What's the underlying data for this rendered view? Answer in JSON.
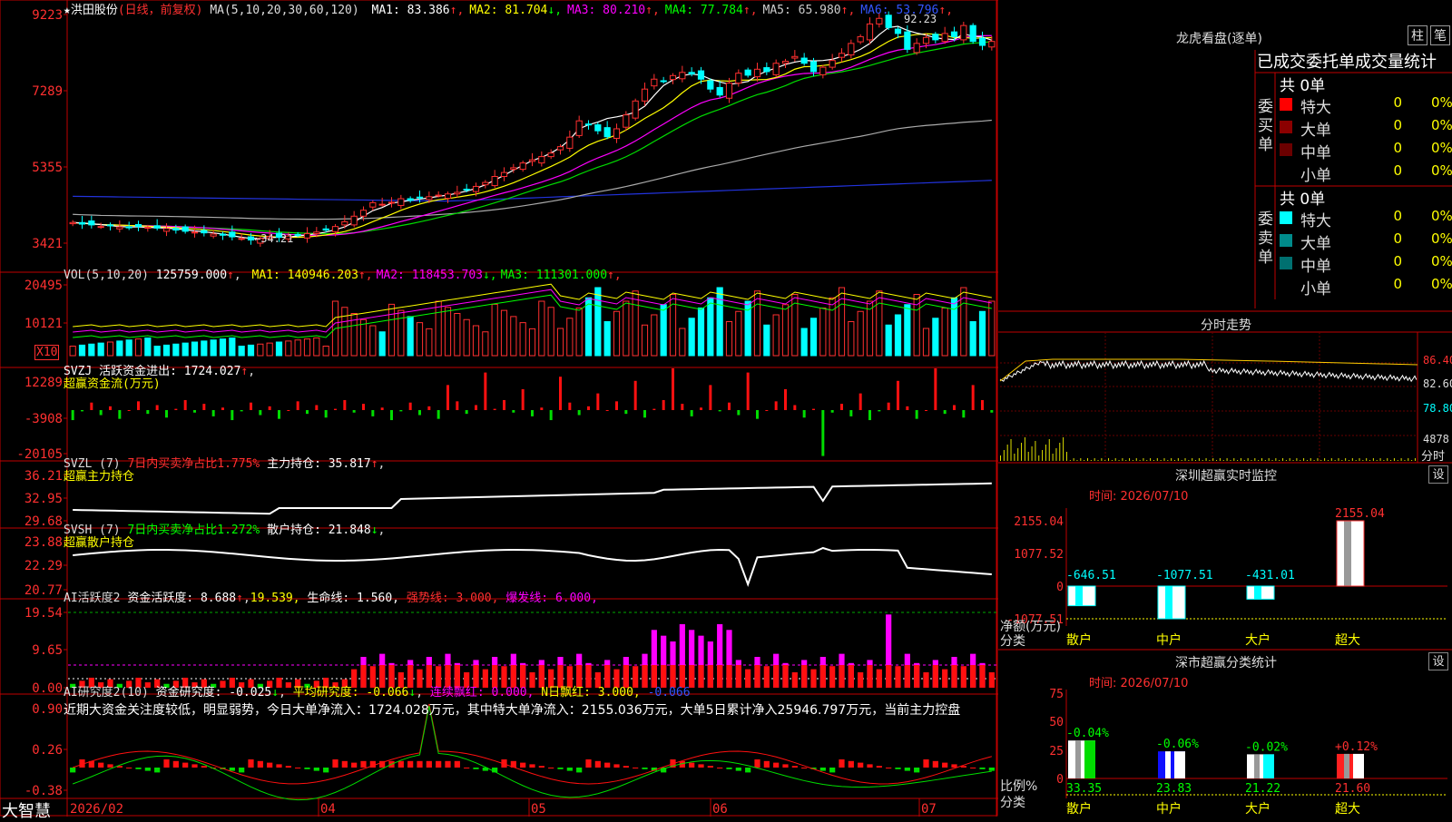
{
  "stock": {
    "name": "洪田股份",
    "star": "★",
    "period": "(日线，前复权)"
  },
  "brand": "大智慧",
  "k_panel": {
    "ma_header": "MA(5,10,20,30,60,120)",
    "ma_values": [
      {
        "label": "MA1: 83.386",
        "arrow": "↑",
        "color": "#ffffff"
      },
      {
        "label": "MA2: 81.704",
        "arrow": "↓",
        "color": "#ffff00"
      },
      {
        "label": "MA3: 80.210",
        "arrow": "↑",
        "color": "#ff00ff"
      },
      {
        "label": "MA4: 77.784",
        "arrow": "↑",
        "color": "#00ff00"
      },
      {
        "label": "MA5: 65.980",
        "arrow": "↑",
        "color": "#cccccc"
      },
      {
        "label": "MA6: 53.796",
        "arrow": "↑",
        "color": "#3355ff"
      }
    ],
    "y_ticks": [
      "9223",
      "7289",
      "5355",
      "3421"
    ],
    "high_label": "92.23",
    "low_label": "←34.21"
  },
  "vol_panel": {
    "header": "VOL(5,10,20)",
    "value": "125759.000",
    "ma_values": [
      {
        "label": "MA1: 140946.203",
        "arrow": "↑",
        "color": "#ffff00"
      },
      {
        "label": "MA2: 118453.703",
        "arrow": "↓",
        "color": "#ff00ff"
      },
      {
        "label": "MA3: 111301.000",
        "arrow": "↑",
        "color": "#00ff00"
      }
    ],
    "y_ticks": [
      "20495",
      "10121"
    ],
    "unit": "X10"
  },
  "svzj_panel": {
    "header": "SVZJ  活跃资金进出: 1724.027",
    "arrow": "↑",
    "sub": "超赢资金流(万元)",
    "y_ticks": [
      "12289",
      "-3908",
      "-20105"
    ]
  },
  "svzl_panel": {
    "header": "SVZL (7)",
    "p1": "7日内买卖净占比1.775%",
    "p2": "主力持仓: 35.817",
    "arrow": "↑",
    "sub": "超赢主力持仓",
    "y_ticks": [
      "36.21",
      "32.95",
      "29.68"
    ]
  },
  "svsh_panel": {
    "header": "SVSH (7)",
    "p1": "7日内买卖净占比1.272%",
    "p2": "散户持仓: 21.848",
    "arrow": "↓",
    "sub": "超赢散户持仓",
    "y_ticks": [
      "23.88",
      "22.29",
      "20.77"
    ]
  },
  "ai_active_panel": {
    "header": "AI活跃度2",
    "p1": "资金活跃度: 8.688",
    "p2": "19.539,",
    "p3": "生命线: 1.560,",
    "p4": "强势线: 3.000,",
    "p5": "爆发线: 6.000,",
    "y_ticks": [
      "19.54",
      "9.65",
      "0.00"
    ]
  },
  "ai_research_panel": {
    "header": "AI研究度2(10)",
    "p1": "资金研究度: -0.025",
    "p2": "平均研究度: -0.066",
    "p3": "连续飘红: 0.000,",
    "p4": "N日飘红: 3.000,",
    "p5": "-0.066",
    "comment": "近期大资金关注度较低，明显弱势，今日大单净流入：1724.028万元，其中特大单净流入：2155.036万元，大单5日累计净入25946.797万元，当前主力控盘",
    "y_ticks": [
      "0.90",
      "0.26",
      "-0.38"
    ]
  },
  "x_axis": [
    "2026/02",
    "04",
    "05",
    "06",
    "07"
  ],
  "right_panel": {
    "dragon_title": "龙虎看盘(逐单)",
    "toggle_bar": "柱",
    "toggle_pen": "笔",
    "stats_title": "已成交委托单成交量统计",
    "buy": {
      "side": "委买单",
      "total": "共 0单",
      "rows": [
        {
          "label": "特大",
          "count": "0",
          "pct": "0%",
          "color": "#ff0000"
        },
        {
          "label": "大单",
          "count": "0",
          "pct": "0%",
          "color": "#8b0000"
        },
        {
          "label": "中单",
          "count": "0",
          "pct": "0%",
          "color": "#6b0000"
        },
        {
          "label": "小单",
          "count": "0",
          "pct": "0%",
          "color": "#000000"
        }
      ]
    },
    "sell": {
      "side": "委卖单",
      "total": "共 0单",
      "rows": [
        {
          "label": "特大",
          "count": "0",
          "pct": "0%",
          "color": "#00ffff"
        },
        {
          "label": "大单",
          "count": "0",
          "pct": "0%",
          "color": "#008b8b"
        },
        {
          "label": "中单",
          "count": "0",
          "pct": "0%",
          "color": "#007070"
        },
        {
          "label": "小单",
          "count": "0",
          "pct": "0%",
          "color": "#000000"
        }
      ]
    },
    "intraday_title": "分时走势",
    "intraday_ticks": [
      "86.40",
      "82.60",
      "78.80"
    ],
    "intraday_vol_tick": "4878",
    "intraday_vol_label": "分时",
    "realtime_title": "深圳超赢实时监控",
    "realtime_time": "时间: 2026/07/10",
    "realtime_yticks": [
      "2155.04",
      "1077.52",
      "0",
      "-1077.51"
    ],
    "realtime_axis_label1": "净额(万元)",
    "realtime_axis_label2": "分类",
    "classify_title": "深市超赢分类统计",
    "classify_time": "时间: 2026/07/10",
    "classify_yticks": [
      "75",
      "50",
      "25",
      "0"
    ],
    "classify_axis_label1": "比例%",
    "classify_axis_label2": "分类",
    "gear": "设"
  },
  "chart_data": [
    {
      "type": "candlestick",
      "name": "洪田股份",
      "y_range": [
        34.21,
        92.23
      ],
      "high": 92.23,
      "low": 34.21,
      "dates_labels": [
        "2026/02",
        "04",
        "05",
        "06",
        "07"
      ],
      "close": [
        39.4,
        39,
        38.8,
        38.4,
        38.6,
        38.3,
        38.1,
        38.4,
        38.2,
        38,
        37.9,
        37.5,
        37.2,
        37,
        36.8,
        36.5,
        36.2,
        35.8,
        35.4,
        35,
        35.4,
        35.9,
        35.7,
        36,
        36.3,
        36.6,
        37,
        37.5,
        38.4,
        39.6,
        41,
        42.5,
        44.4,
        44,
        44.5,
        45.4,
        45,
        45.6,
        45.9,
        46.3,
        46.6,
        47,
        47.6,
        48.5,
        49.5,
        51,
        52,
        53.2,
        54.4,
        55.2,
        56,
        56.9,
        58.5,
        60.9,
        65,
        64,
        62.5,
        61,
        63,
        66.5,
        70,
        73,
        75.5,
        75,
        76.4,
        77.2,
        76.8,
        75.5,
        73,
        71.5,
        74.5,
        77,
        76.5,
        78,
        77.4,
        79.5,
        80,
        81.2,
        79.5,
        77.4,
        78.5,
        80.2,
        82,
        84.5,
        86.2,
        89.4,
        90.8,
        88.5,
        87,
        83,
        84.5,
        86,
        85.4,
        87,
        86.2,
        89,
        85,
        84,
        85
      ],
      "ma5": [
        39.4,
        39.3,
        39.1,
        38.9,
        38.6,
        38.4,
        38.3,
        38.3,
        38.2,
        38.1,
        38,
        37.8,
        37.6,
        37.3,
        37.1,
        36.8,
        36.5,
        36.1,
        35.7,
        35.4,
        35.4,
        35.6,
        35.7,
        35.8,
        36,
        36.3,
        36.6,
        37,
        37.6,
        38.3,
        39.5,
        41,
        42.4,
        43.2,
        44.3,
        44.6,
        45,
        45.3,
        45.6,
        46,
        46.3,
        46.8,
        47.3,
        48,
        48.9,
        50.1,
        51.3,
        52.6,
        53.8,
        55,
        55.8,
        56.9,
        58.3,
        60.3,
        63,
        64,
        64.7,
        65.6,
        66,
        66.5,
        67.2,
        68.7,
        71.4,
        73.9,
        75.3,
        76.4,
        76.8,
        76.5,
        75.5,
        74.8,
        74.2,
        74.5,
        74.9,
        76.5,
        77.5,
        78.3,
        79.2,
        79.8,
        80.2,
        80.1,
        80.2,
        80.5,
        81.2,
        81.9,
        83,
        84.5,
        86.7,
        88.5,
        88.8,
        87.8,
        87.1,
        86.6,
        85.9,
        85.6,
        85.5,
        86.9,
        86.3,
        86.1,
        85.3
      ]
    },
    {
      "type": "bar",
      "name": "VOL",
      "y_range": [
        0,
        24000
      ],
      "y_ticks": [
        20495,
        10121
      ],
      "unit": "X10"
    },
    {
      "type": "bar",
      "name": "SVZJ 超赢资金流(万元)",
      "y_range": [
        -20105,
        12289
      ]
    },
    {
      "type": "line",
      "name": "SVZL 超赢主力持仓",
      "y_range": [
        29.68,
        36.21
      ]
    },
    {
      "type": "line",
      "name": "SVSH 超赢散户持仓",
      "y_range": [
        20.77,
        23.88
      ]
    },
    {
      "type": "bar",
      "name": "AI活跃度2",
      "y_range": [
        0,
        19.54
      ],
      "guides": [
        3,
        6
      ]
    },
    {
      "type": "bar",
      "name": "AI研究度2(10)",
      "y_range": [
        -0.38,
        0.9
      ]
    },
    {
      "type": "bar",
      "name": "深圳超赢实时监控",
      "categories": [
        "散户",
        "中户",
        "大户",
        "超大"
      ],
      "values": [
        -646.51,
        -1077.51,
        -431.01,
        2155.04
      ],
      "labels": [
        "-646.51",
        "-1077.51",
        "-431.01",
        "2155.04"
      ],
      "y_range": [
        -1077.51,
        2155.04
      ]
    },
    {
      "type": "bar",
      "name": "深市超赢分类统计",
      "categories": [
        "散户",
        "中户",
        "大户",
        "超大"
      ],
      "values": [
        33.35,
        23.83,
        21.22,
        21.6
      ],
      "changes": [
        "-0.04%",
        "-0.06%",
        "-0.02%",
        "+0.12%"
      ],
      "y_range": [
        0,
        75
      ]
    }
  ]
}
